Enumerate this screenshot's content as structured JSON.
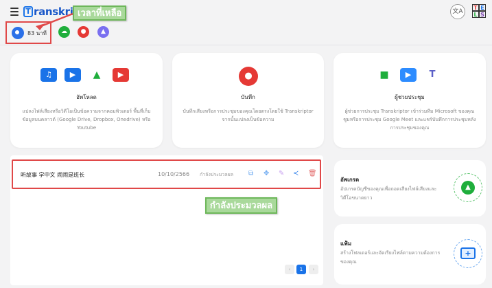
{
  "header": {
    "logo_letter": "T",
    "logo_text": "ranskriptor",
    "callout_time": "เวลาที่เหลือ",
    "lang_icon": "translate-icon",
    "tels": [
      "T",
      "E",
      "L",
      "S"
    ]
  },
  "toolbar": {
    "remaining_time": "83 นาที",
    "buttons": [
      "upload-cloud-icon",
      "microphone-icon",
      "assistant-bot-icon"
    ]
  },
  "cards": {
    "upload": {
      "title": "อัพโหลด",
      "description": "แปลงไฟล์เสียงหรือวิดีโอเป็นข้อความจากคอมพิวเตอร์ พื้นที่เก็บข้อมูลบนคลาวด์ (Google Drive, Dropbox, Onedrive) หรือ Youtube",
      "icons": [
        "music-file-icon",
        "video-file-icon",
        "google-drive-icon",
        "youtube-icon"
      ]
    },
    "record": {
      "title": "บันทึก",
      "description": "บันทึกเสียงหรือการประชุมของคุณโดยตรงโดยใช้ Transkriptor จากนั้นแปลงเป็นข้อความ",
      "icon": "microphone-icon"
    },
    "assistant": {
      "title": "ผู้ช่วยประชุม",
      "description": "ผู้ช่วยการประชุม Transkriptor เข้าร่วมทีม Microsoft ของคุณ ซูมหรือการประชุม Google Meet และแชร์บันทึกการประชุมหลังการประชุมของคุณ",
      "icons": [
        "google-meet-icon",
        "zoom-icon",
        "teams-icon"
      ]
    }
  },
  "files": [
    {
      "name": "听故事 学中文 闹闹是班长",
      "date": "10/10/2566",
      "status": "กำลังประมวลผล"
    }
  ],
  "callout_processing": "กำลังประมวลผล",
  "pagination": {
    "prev": "‹",
    "current": "1",
    "next": "›"
  },
  "side": {
    "upgrade": {
      "title": "อัพเกรด",
      "description": "อัปเกรดบัญชีของคุณเพื่อถอดเสียงไฟล์เสียงและวิดีโอขนาดยาว"
    },
    "folder": {
      "title": "แฟ้ม",
      "description": "สร้างโฟลเดอร์และจัดเรียงไฟล์ตามความต้องการของคุณ"
    }
  },
  "colors": {
    "accent": "#1a73e8",
    "highlight_border": "#e04848",
    "callout_green": "#a9d99b"
  }
}
